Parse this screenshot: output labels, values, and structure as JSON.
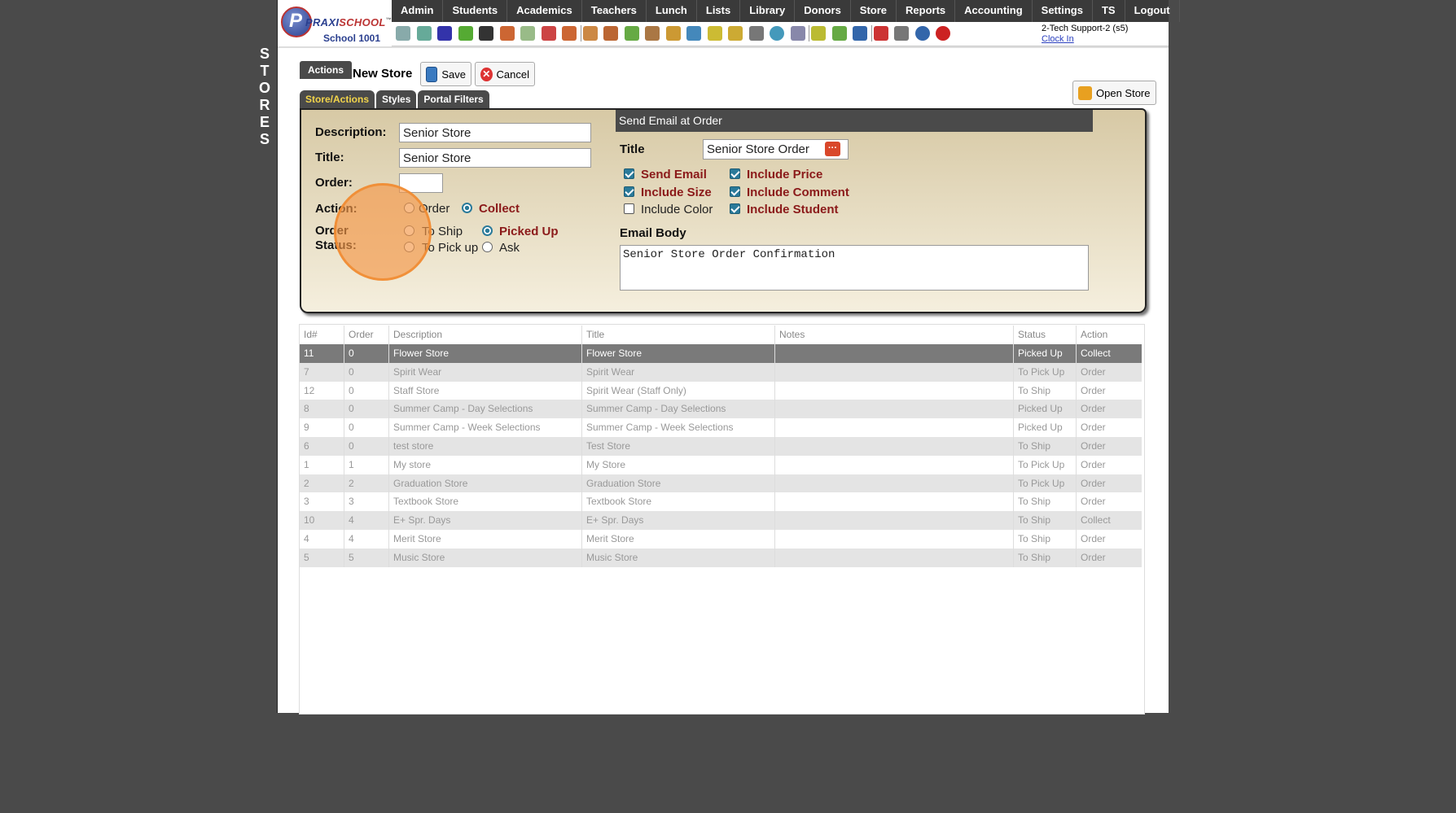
{
  "side_word": [
    "S",
    "T",
    "O",
    "R",
    "E",
    "S"
  ],
  "logo": {
    "brand_a": "PRAXI",
    "brand_b": "SCHOOL",
    "trademark": "™",
    "school": "School 1001"
  },
  "nav": [
    "Admin",
    "Students",
    "Academics",
    "Teachers",
    "Lunch",
    "Lists",
    "Library",
    "Donors",
    "Store",
    "Reports",
    "Accounting",
    "Settings",
    "TS",
    "Logout"
  ],
  "user": {
    "name": "2-Tech Support-2 (s5)",
    "clock": "Clock In"
  },
  "toolbar": {
    "actions_label": "Actions",
    "title": "New Store",
    "save_label": "Save",
    "cancel_label": "Cancel",
    "open_store_label": "Open Store"
  },
  "tabs": [
    "Store/Actions",
    "Styles",
    "Portal Filters"
  ],
  "form": {
    "description_label": "Description:",
    "description_value": "Senior Store",
    "title_label": "Title:",
    "title_value": "Senior Store",
    "order_label": "Order:",
    "order_value": "",
    "action_label": "Action:",
    "action_options": [
      "Order",
      "Collect"
    ],
    "action_selected": "Collect",
    "status_label_1": "Order",
    "status_label_2": "Status:",
    "status_options": [
      "To Ship",
      "Picked Up",
      "To Pick up",
      "Ask"
    ],
    "status_selected": "Picked Up"
  },
  "email": {
    "header": "Send Email at Order",
    "title_label": "Title",
    "title_value": "Senior Store Order",
    "checks": [
      {
        "label": "Send Email",
        "checked": true
      },
      {
        "label": "Include Price",
        "checked": true
      },
      {
        "label": "Include Size",
        "checked": true
      },
      {
        "label": "Include Comment",
        "checked": true
      },
      {
        "label": "Include Color",
        "checked": false
      },
      {
        "label": "Include Student",
        "checked": true
      }
    ],
    "body_label": "Email Body",
    "body_value": "Senior Store Order Confirmation"
  },
  "table": {
    "headers": [
      "Id#",
      "Order",
      "Description",
      "Title",
      "Notes",
      "Status",
      "Action"
    ],
    "rows": [
      [
        "11",
        "0",
        "Flower Store",
        "Flower Store",
        "",
        "Picked Up",
        "Collect"
      ],
      [
        "7",
        "0",
        "Spirit Wear",
        "Spirit Wear",
        "",
        "To Pick Up",
        "Order"
      ],
      [
        "12",
        "0",
        "Staff Store",
        "Spirit Wear (Staff Only)",
        "",
        "To Ship",
        "Order"
      ],
      [
        "8",
        "0",
        "Summer Camp - Day Selections",
        "Summer Camp - Day Selections",
        "",
        "Picked Up",
        "Order"
      ],
      [
        "9",
        "0",
        "Summer Camp - Week Selections",
        "Summer Camp - Week Selections",
        "",
        "Picked Up",
        "Order"
      ],
      [
        "6",
        "0",
        "test store",
        "Test Store",
        "",
        "To Ship",
        "Order"
      ],
      [
        "1",
        "1",
        "My store",
        "My Store",
        "",
        "To Pick Up",
        "Order"
      ],
      [
        "2",
        "2",
        "Graduation Store",
        "Graduation Store",
        "",
        "To Pick Up",
        "Order"
      ],
      [
        "3",
        "3",
        "Textbook Store",
        "Textbook Store",
        "",
        "To Ship",
        "Order"
      ],
      [
        "10",
        "4",
        "E+ Spr. Days",
        "E+ Spr. Days",
        "",
        "To Ship",
        "Collect"
      ],
      [
        "4",
        "4",
        "Merit Store",
        "Merit Store",
        "",
        "To Ship",
        "Order"
      ],
      [
        "5",
        "5",
        "Music Store",
        "Music Store",
        "",
        "To Ship",
        "Order"
      ]
    ]
  },
  "colors": {
    "nav_bg": "#3a3a3a",
    "accent_text": "#8b1a1a",
    "tab_active": "#f2d44a",
    "panel_top": "#d7c9a5"
  }
}
